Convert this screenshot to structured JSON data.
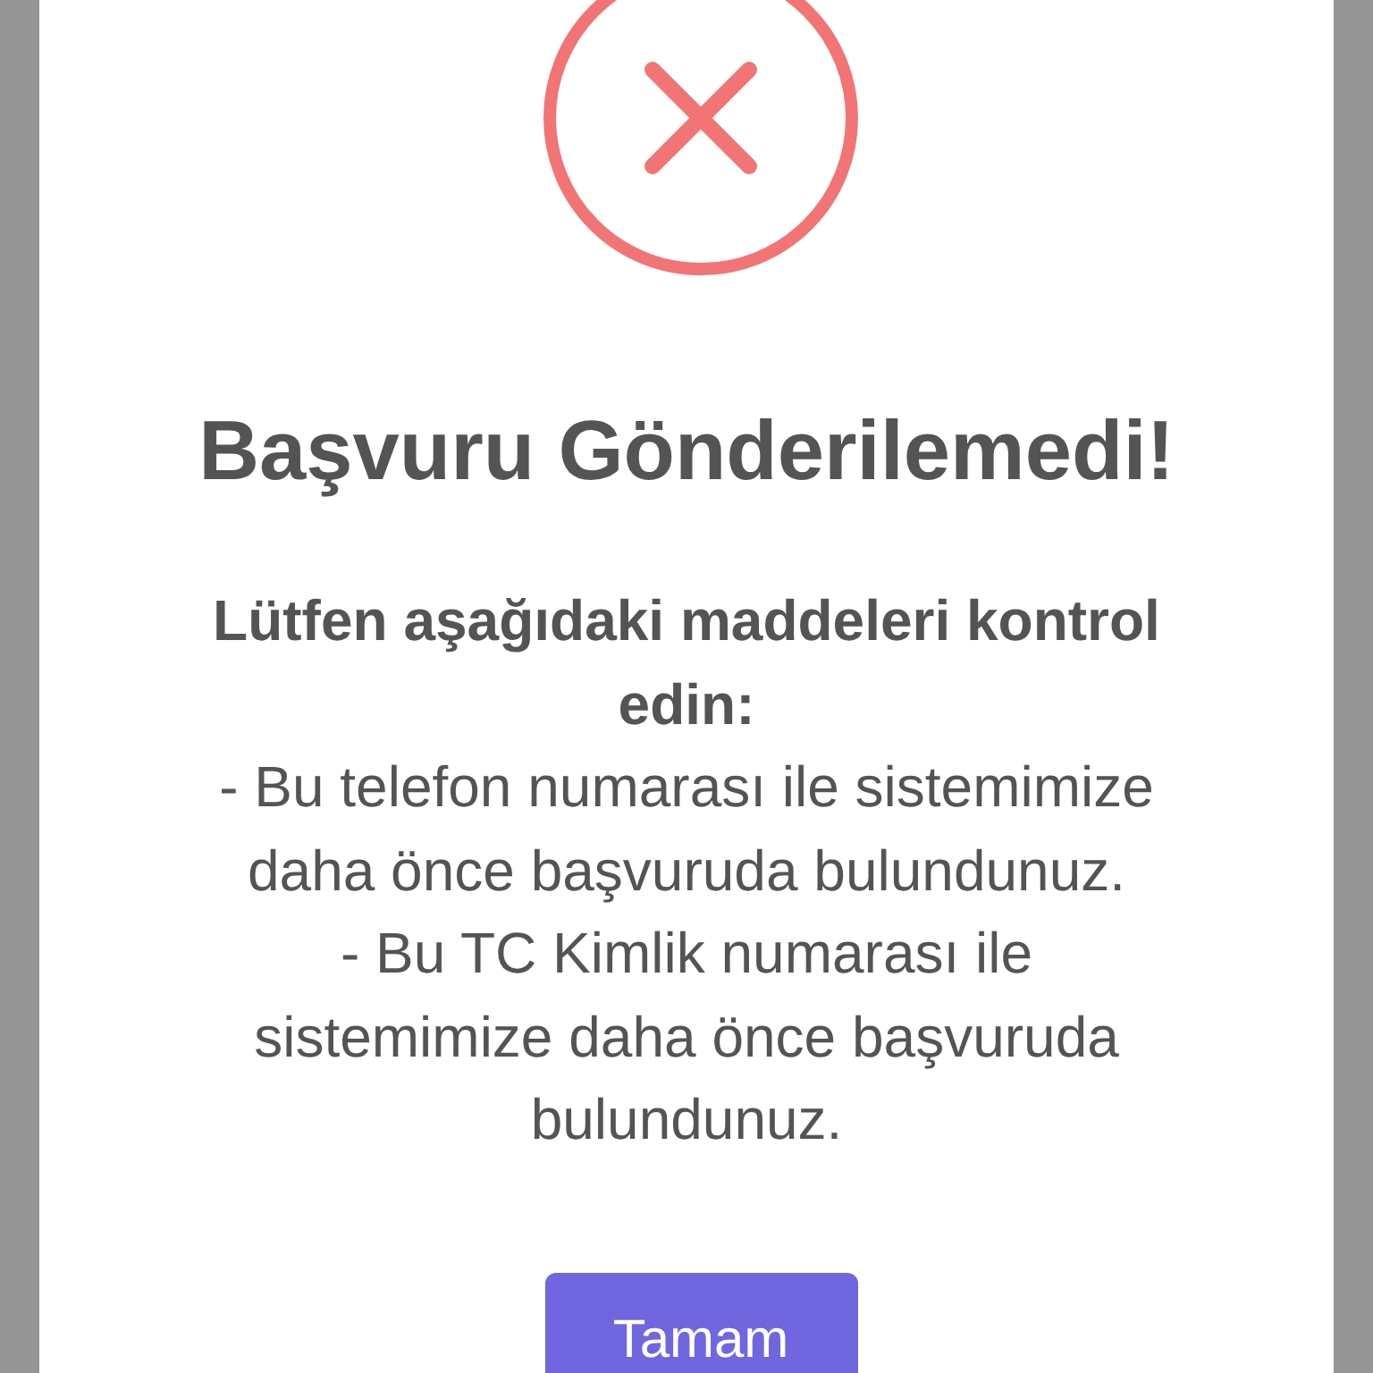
{
  "dialog": {
    "icon": {
      "kind": "error"
    },
    "title": "Başvuru Gönderilemedi!",
    "message": [
      {
        "kind": "heading",
        "text": "Lütfen aşağıdaki maddeleri kontrol edin:"
      },
      {
        "kind": "item",
        "text": "- Bu telefon numarası ile sistemimize daha önce başvuruda bulundunuz."
      },
      {
        "kind": "item",
        "text": "- Bu TC Kimlik numarası ile sistemimize daha önce başvuruda bulundunuz."
      }
    ],
    "confirm_button": "Tamam"
  }
}
